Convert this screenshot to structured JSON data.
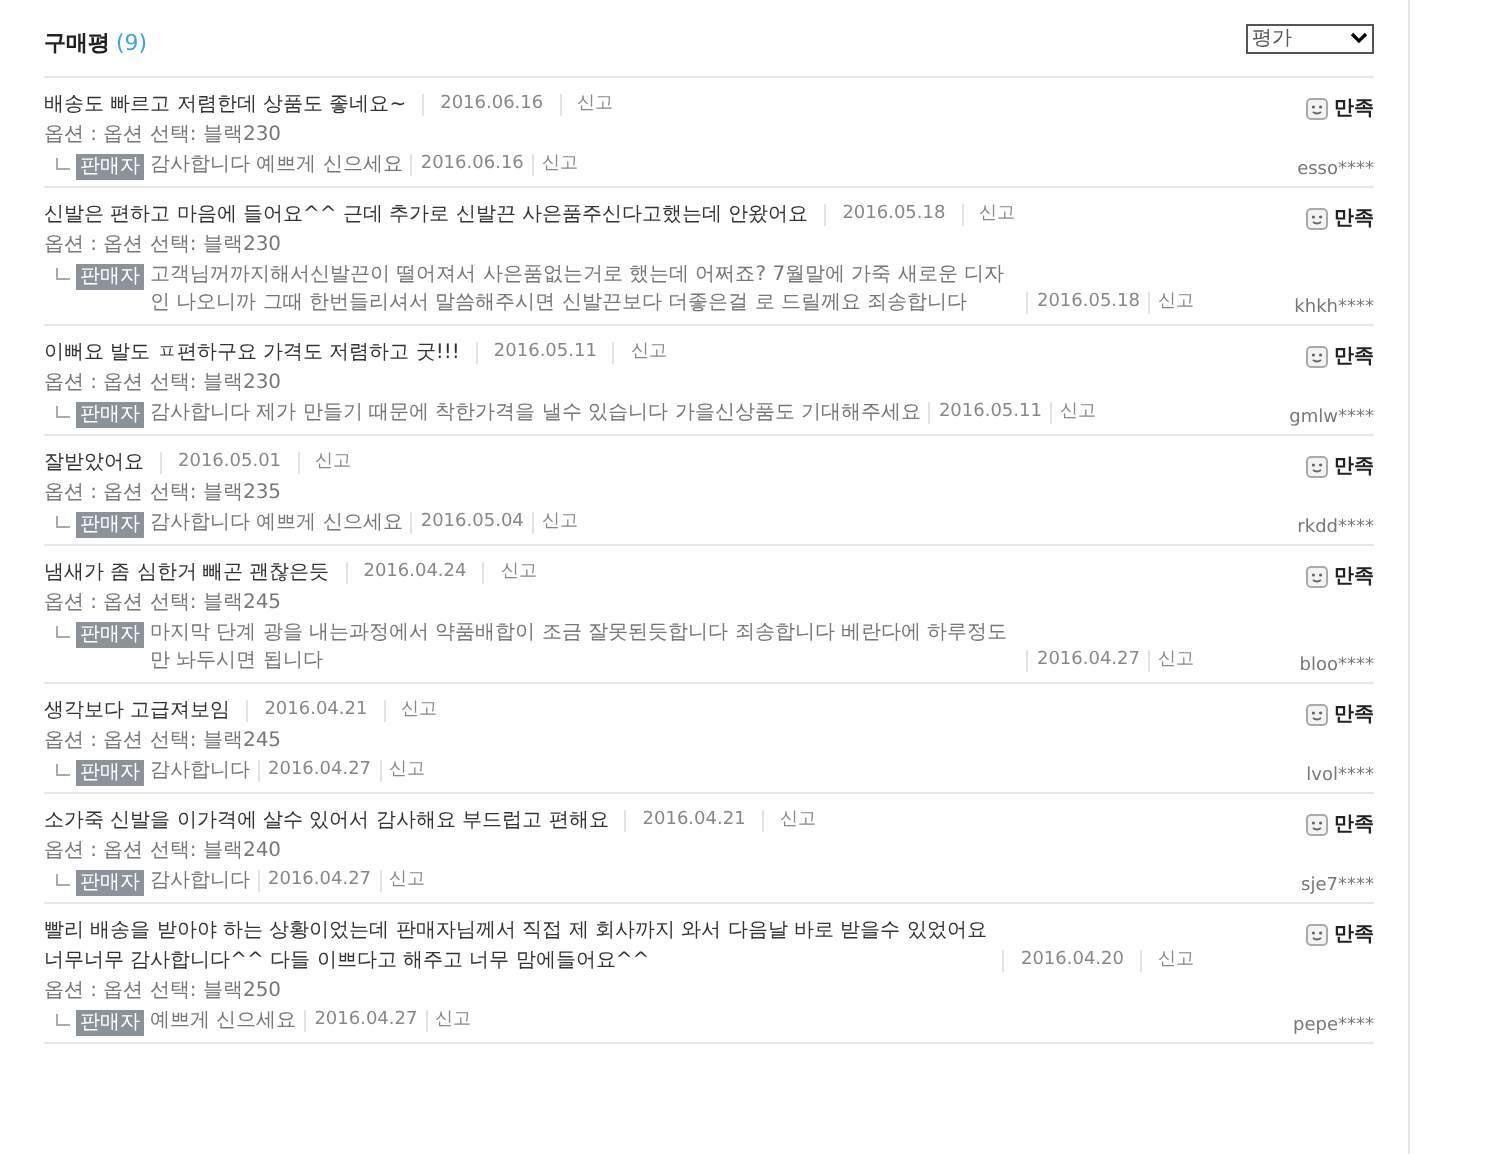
{
  "header": {
    "title": "구매평",
    "count": "(9)"
  },
  "filter": {
    "value": "평가"
  },
  "reviews": [
    {
      "text": "배송도 빠르고 저렴한데 상품도 좋네요~",
      "date": "2016.06.16",
      "report": "신고",
      "option": "옵션 : 옵션 선택: 블랙230",
      "rating": "만족",
      "user": "esso****",
      "reply": {
        "badge": "판매자",
        "text": "감사합니다 예쁘게 신으세요",
        "date": "2016.06.16",
        "report": "신고"
      }
    },
    {
      "text": "신발은 편하고 마음에 들어요^^ 근데 추가로 신발끈 사은품주신다고했는데 안왔어요",
      "date": "2016.05.18",
      "report": "신고",
      "option": "옵션 : 옵션 선택: 블랙230",
      "rating": "만족",
      "user": "khkh****",
      "reply": {
        "badge": "판매자",
        "text": "고객님꺼까지해서신발끈이 떨어져서 사은품없는거로 했는데 어쩌죠? 7월말에 가죽 새로운 디자인 나오니까 그때 한번들리셔서 말씀해주시면 신발끈보다 더좋은걸 로 드릴께요 죄송합니다",
        "date": "2016.05.18",
        "report": "신고"
      }
    },
    {
      "text": "이뻐요 발도 ㅍ편하구요 가격도 저렴하고 굿!!!",
      "date": "2016.05.11",
      "report": "신고",
      "option": "옵션 : 옵션 선택: 블랙230",
      "rating": "만족",
      "user": "gmlw****",
      "reply": {
        "badge": "판매자",
        "text": "감사합니다 제가 만들기 때문에 착한가격을 낼수 있습니다 가을신상품도 기대해주세요",
        "date": "2016.05.11",
        "report": "신고"
      }
    },
    {
      "text": "잘받았어요",
      "date": "2016.05.01",
      "report": "신고",
      "option": "옵션 : 옵션 선택: 블랙235",
      "rating": "만족",
      "user": "rkdd****",
      "reply": {
        "badge": "판매자",
        "text": "감사합니다 예쁘게 신으세요",
        "date": "2016.05.04",
        "report": "신고"
      }
    },
    {
      "text": "냄새가 좀 심한거 빼곤 괜찮은듯",
      "date": "2016.04.24",
      "report": "신고",
      "option": "옵션 : 옵션 선택: 블랙245",
      "rating": "만족",
      "user": "bloo****",
      "reply": {
        "badge": "판매자",
        "text": "마지막 단계 광을 내는과정에서 약품배합이 조금 잘못된듯합니다 죄송합니다 베란다에 하루정도만 놔두시면 됩니다",
        "date": "2016.04.27",
        "report": "신고"
      }
    },
    {
      "text": "생각보다 고급져보임",
      "date": "2016.04.21",
      "report": "신고",
      "option": "옵션 : 옵션 선택: 블랙245",
      "rating": "만족",
      "user": "lvol****",
      "reply": {
        "badge": "판매자",
        "text": "감사합니다",
        "date": "2016.04.27",
        "report": "신고"
      }
    },
    {
      "text": "소가죽 신발을 이가격에 살수 있어서 감사해요 부드럽고 편해요",
      "date": "2016.04.21",
      "report": "신고",
      "option": "옵션 : 옵션 선택: 블랙240",
      "rating": "만족",
      "user": "sje7****",
      "reply": {
        "badge": "판매자",
        "text": "감사합니다",
        "date": "2016.04.27",
        "report": "신고"
      }
    },
    {
      "text": "빨리 배송을 받아야 하는 상황이었는데 판매자님께서 직접 제 회사까지 와서 다음날 바로 받을수 있었어요 너무너무 감사합니다^^ 다들 이쁘다고 해주고 너무 맘에들어요^^",
      "date": "2016.04.20",
      "report": "신고",
      "option": "옵션 : 옵션 선택: 블랙250",
      "rating": "만족",
      "user": "pepe****",
      "reply": {
        "badge": "판매자",
        "text": "예쁘게 신으세요",
        "date": "2016.04.27",
        "report": "신고"
      }
    }
  ]
}
